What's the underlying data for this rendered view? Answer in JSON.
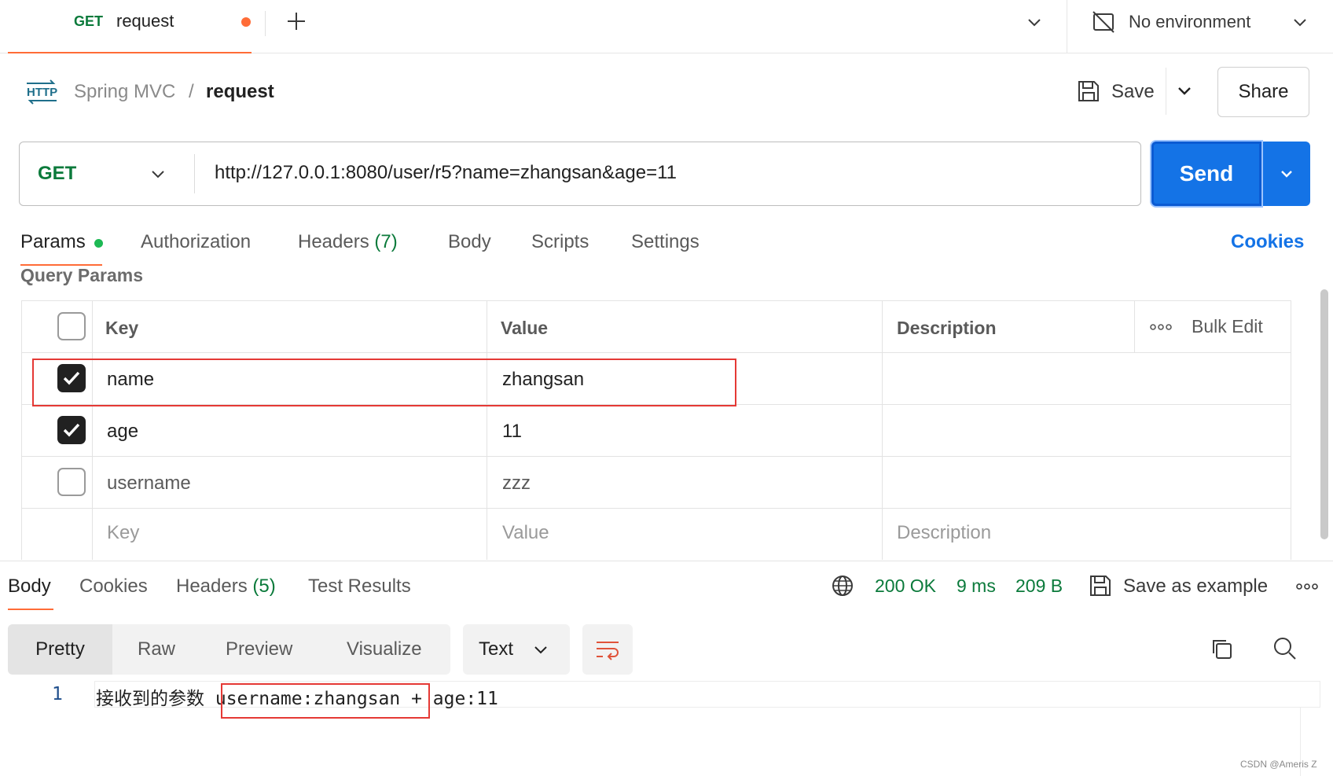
{
  "tabbar": {
    "tab": {
      "method": "GET",
      "title": "request"
    },
    "environment": {
      "label": "No environment"
    }
  },
  "header": {
    "collection": "Spring MVC",
    "separator": "/",
    "request_name": "request",
    "save_label": "Save",
    "share_label": "Share"
  },
  "request": {
    "method": "GET",
    "url": "http://127.0.0.1:8080/user/r5?name=zhangsan&age=11",
    "send_label": "Send"
  },
  "request_tabs": {
    "params": "Params",
    "authorization": "Authorization",
    "headers": "Headers",
    "headers_count": "(7)",
    "body": "Body",
    "scripts": "Scripts",
    "settings": "Settings",
    "cookies": "Cookies"
  },
  "query_params": {
    "title": "Query Params",
    "columns": {
      "key": "Key",
      "value": "Value",
      "description": "Description",
      "bulk_edit": "Bulk Edit"
    },
    "rows": [
      {
        "checked": true,
        "key": "name",
        "value": "zhangsan",
        "description": ""
      },
      {
        "checked": true,
        "key": "age",
        "value": "11",
        "description": ""
      },
      {
        "checked": false,
        "key": "username",
        "value": "zzz",
        "description": ""
      }
    ],
    "placeholders": {
      "key": "Key",
      "value": "Value",
      "description": "Description"
    }
  },
  "response": {
    "tabs": {
      "body": "Body",
      "cookies": "Cookies",
      "headers": "Headers",
      "headers_count": "(5)",
      "test_results": "Test Results"
    },
    "status": {
      "code": "200 OK",
      "time": "9 ms",
      "size": "209 B"
    },
    "save_example_label": "Save as example",
    "formats": {
      "pretty": "Pretty",
      "raw": "Raw",
      "preview": "Preview",
      "visualize": "Visualize"
    },
    "language": "Text",
    "lines": [
      {
        "number": "1",
        "text": "接收到的参数 username:zhangsan + age:11"
      }
    ]
  },
  "watermark": "CSDN @Ameris Z",
  "colors": {
    "accent": "#ff6c37",
    "send_blue": "#1473e6",
    "get_green": "#0b7a3b",
    "highlight_red": "#e53935"
  }
}
